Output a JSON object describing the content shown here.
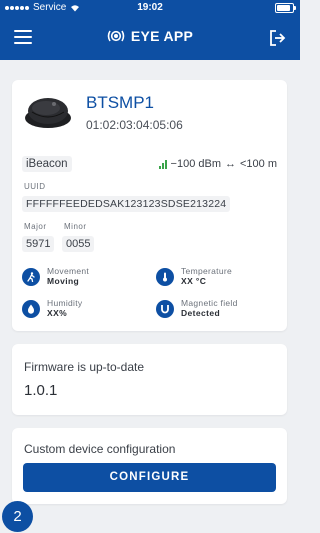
{
  "status_bar": {
    "carrier": "Service",
    "time": "19:02"
  },
  "navbar": {
    "title": "EYE APP"
  },
  "device": {
    "name": "BTSMP1",
    "mac": "01:02:03:04:05:06",
    "protocol": "iBeacon",
    "rssi": "−100 dBm",
    "distance": "<100 m",
    "uuid_label": "UUID",
    "uuid": "FFFFFFEEDEDSAK123123SDSE213224",
    "major_label": "Major",
    "major": "5971",
    "minor_label": "Minor",
    "minor": "0055"
  },
  "sensors": {
    "movement": {
      "label": "Movement",
      "value": "Moving",
      "icon": "running-person-icon"
    },
    "temperature": {
      "label": "Temperature",
      "value": "XX °C",
      "icon": "thermometer-icon"
    },
    "humidity": {
      "label": "Humidity",
      "value": "XX%",
      "icon": "water-drop-icon"
    },
    "magnetic": {
      "label": "Magnetic field",
      "value": "Detected",
      "icon": "magnet-icon"
    }
  },
  "firmware": {
    "status": "Firmware is up-to-date",
    "version": "1.0.1"
  },
  "configuration": {
    "title": "Custom device configuration",
    "button_label": "CONFIGURE"
  },
  "badge": {
    "count": "2"
  },
  "colors": {
    "primary": "#0d4fa3",
    "signal_green": "#3aa44a",
    "background": "#eef0f3"
  }
}
